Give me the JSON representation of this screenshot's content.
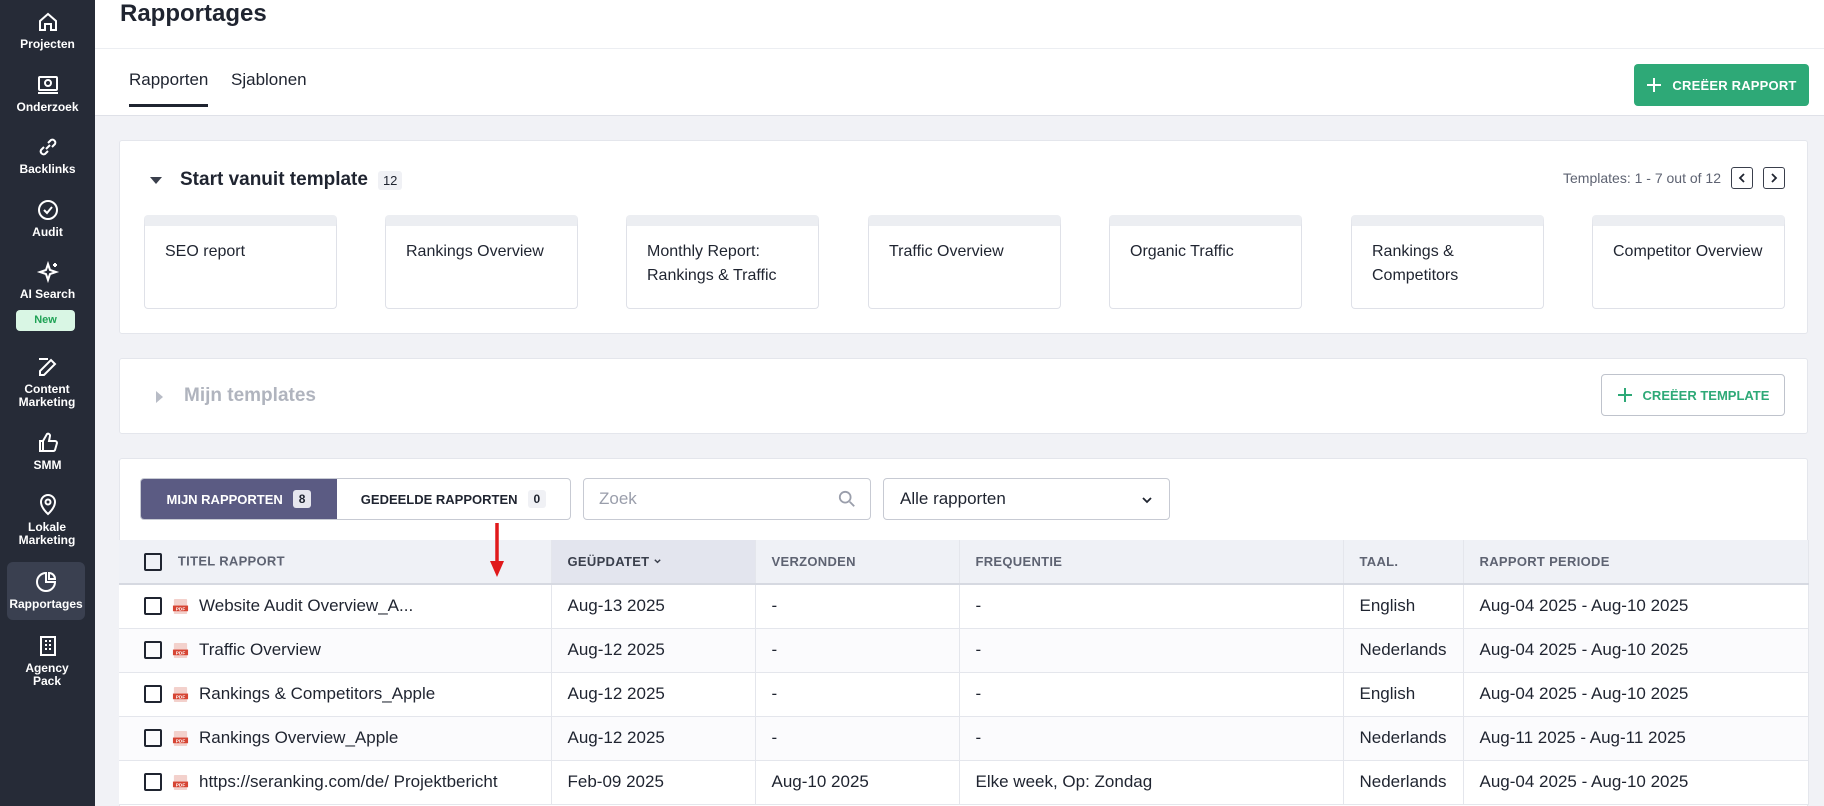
{
  "sidebar": {
    "items": [
      {
        "label": "Projecten",
        "icon": "home-icon"
      },
      {
        "label": "Onderzoek",
        "icon": "research-icon"
      },
      {
        "label": "Backlinks",
        "icon": "link-icon"
      },
      {
        "label": "Audit",
        "icon": "check-circle-icon"
      },
      {
        "label": "AI Search",
        "icon": "sparkles-icon",
        "badge": "New"
      },
      {
        "label": "Content Marketing",
        "icon": "edit-icon"
      },
      {
        "label": "SMM",
        "icon": "thumbs-up-icon"
      },
      {
        "label": "Lokale Marketing",
        "icon": "location-pin-icon"
      },
      {
        "label": "Rapportages",
        "icon": "pie-chart-icon",
        "active": true
      },
      {
        "label": "Agency Pack",
        "icon": "building-icon"
      }
    ]
  },
  "header": {
    "title": "Rapportages",
    "tabs": [
      {
        "label": "Rapporten",
        "active": true
      },
      {
        "label": "Sjablonen",
        "active": false
      }
    ],
    "create_report_label": "CREËER RAPPORT"
  },
  "templates": {
    "title": "Start vanuit template",
    "count": "12",
    "pager_text": "Templates: 1 - 7 out of 12",
    "items": [
      "SEO report",
      "Rankings Overview",
      "Monthly Report: Rankings & Traffic",
      "Traffic Overview",
      "Organic Traffic",
      "Rankings & Competitors",
      "Competitor Overview"
    ]
  },
  "my_templates": {
    "title": "Mijn templates",
    "create_label": "CREËER TEMPLATE"
  },
  "reports": {
    "segments": [
      {
        "label": "MIJN RAPPORTEN",
        "count": "8",
        "active": true
      },
      {
        "label": "GEDEELDE RAPPORTEN",
        "count": "0",
        "active": false
      }
    ],
    "search_placeholder": "Zoek",
    "filter_selected": "Alle rapporten",
    "columns": [
      "TITEL RAPPORT",
      "GEÜPDATET",
      "VERZONDEN",
      "FREQUENTIE",
      "TAAL.",
      "RAPPORT PERIODE"
    ],
    "rows": [
      {
        "title": "Website Audit Overview_A...",
        "updated": "Aug-13 2025",
        "sent": "-",
        "frequency": "-",
        "language": "English",
        "period": "Aug-04 2025 - Aug-10 2025"
      },
      {
        "title": "Traffic Overview",
        "updated": "Aug-12 2025",
        "sent": "-",
        "frequency": "-",
        "language": "Nederlands",
        "period": "Aug-04 2025 - Aug-10 2025"
      },
      {
        "title": "Rankings & Competitors_Apple",
        "updated": "Aug-12 2025",
        "sent": "-",
        "frequency": "-",
        "language": "English",
        "period": "Aug-04 2025 - Aug-10 2025"
      },
      {
        "title": "Rankings Overview_Apple",
        "updated": "Aug-12 2025",
        "sent": "-",
        "frequency": "-",
        "language": "Nederlands",
        "period": "Aug-11 2025 - Aug-11 2025"
      },
      {
        "title": "https://seranking.com/de/ Projektbericht",
        "updated": "Feb-09 2025",
        "sent": "Aug-10 2025",
        "frequency": "Elke week, Op: Zondag",
        "language": "Nederlands",
        "period": "Aug-04 2025 - Aug-10 2025"
      }
    ]
  },
  "colors": {
    "sidebar_bg": "#262b37",
    "accent_green": "#2ea977",
    "segment_active": "#5b5b83",
    "highlight_red": "#e0191b"
  }
}
